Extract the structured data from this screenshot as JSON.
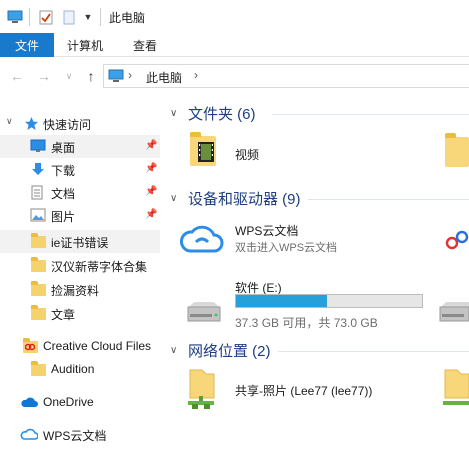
{
  "window": {
    "title": "此电脑"
  },
  "ribbon": {
    "tabs": [
      "文件",
      "计算机",
      "查看"
    ]
  },
  "address": {
    "path": "此电脑",
    "chevron": "›"
  },
  "nav": {
    "quick_access": "快速访问",
    "items": [
      {
        "label": "桌面",
        "icon": "desktop-icon",
        "pinned": true
      },
      {
        "label": "下载",
        "icon": "download-arrow-icon",
        "pinned": true
      },
      {
        "label": "文档",
        "icon": "document-icon",
        "pinned": true
      },
      {
        "label": "图片",
        "icon": "picture-icon",
        "pinned": true
      },
      {
        "label": "ie证书错误",
        "icon": "folder-icon"
      },
      {
        "label": "汉仪新蒂字体合集",
        "icon": "folder-icon"
      },
      {
        "label": "捡漏资料",
        "icon": "folder-icon"
      },
      {
        "label": "文章",
        "icon": "folder-icon"
      }
    ],
    "creative_cloud": "Creative Cloud Files",
    "audition": "Audition",
    "onedrive": "OneDrive",
    "wps": "WPS云文档"
  },
  "content": {
    "folders_header": "文件夹 (6)",
    "folder_items": [
      {
        "label": "视频",
        "icon": "video-folder-icon"
      }
    ],
    "devices_header": "设备和驱动器 (9)",
    "wps_drive": {
      "label": "WPS云文档",
      "sub": "双击进入WPS云文档"
    },
    "software_drive": {
      "label": "软件 (E:)",
      "free_text": "37.3 GB 可用，共 73.0 GB",
      "used_fraction": 0.49
    },
    "network_header": "网络位置 (2)",
    "network_items": [
      {
        "label": "共享-照片 (Lee77 (lee77))"
      }
    ]
  },
  "colors": {
    "accent": "#1979ca",
    "group_header": "#1e3e80",
    "drive_fill": "#26a0da",
    "folder": "#f7d77a"
  }
}
